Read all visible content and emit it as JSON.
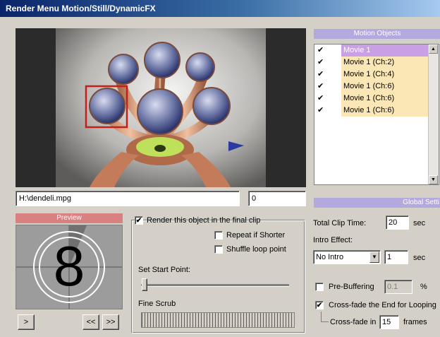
{
  "window": {
    "title": "Render Menu Motion/Still/DynamicFX"
  },
  "viewer": {
    "file_path": "H:\\dendeli.mpg",
    "frame_value": "0"
  },
  "motion_objects": {
    "header": "Motion Objects",
    "items": [
      {
        "label": "Movie 1",
        "checked": true,
        "selected": true
      },
      {
        "label": "Movie 1 (Ch:2)",
        "checked": true,
        "selected": false
      },
      {
        "label": "Movie 1 (Ch:4)",
        "checked": true,
        "selected": false
      },
      {
        "label": "Movie 1 (Ch:6)",
        "checked": true,
        "selected": false
      },
      {
        "label": "Movie 1 (Ch:6)",
        "checked": true,
        "selected": false
      },
      {
        "label": "Movie 1 (Ch:6)",
        "checked": true,
        "selected": false
      }
    ]
  },
  "preview": {
    "header": "Preview",
    "countdown_number": "8",
    "play_button": ">",
    "rewind_button": "<<",
    "forward_button": ">>"
  },
  "options": {
    "render_label": "Render this object in the final clip",
    "render_checked": true,
    "repeat_label": "Repeat if Shorter",
    "repeat_checked": false,
    "shuffle_label": "Shuffle loop point",
    "shuffle_checked": false,
    "start_point_label": "Set Start Point:",
    "start_point_value": 0.0,
    "fine_scrub_label": "Fine Scrub"
  },
  "global_settings": {
    "header": "Global Setti",
    "total_clip_label": "Total Clip Time:",
    "total_clip_value": "20",
    "total_clip_unit": "sec",
    "intro_effect_label": "Intro Effect:",
    "intro_effect_selected": "No Intro",
    "intro_value": "1",
    "intro_unit": "sec",
    "prebuffering_label": "Pre-Buffering",
    "prebuffering_checked": false,
    "prebuffering_value": "0.1",
    "prebuffering_unit": "%",
    "crossfade_label": "Cross-fade the End for Looping",
    "crossfade_checked": true,
    "crossfade_in_label": "Cross-fade in",
    "crossfade_in_value": "15",
    "crossfade_in_unit": "frames"
  },
  "colors": {
    "title_gradient_start": "#0a246a",
    "header_bar": "#b3a9de",
    "list_item_bg": "#fbe7b5",
    "list_selected_bg": "#c9a0e6",
    "preview_header": "#d98080"
  }
}
